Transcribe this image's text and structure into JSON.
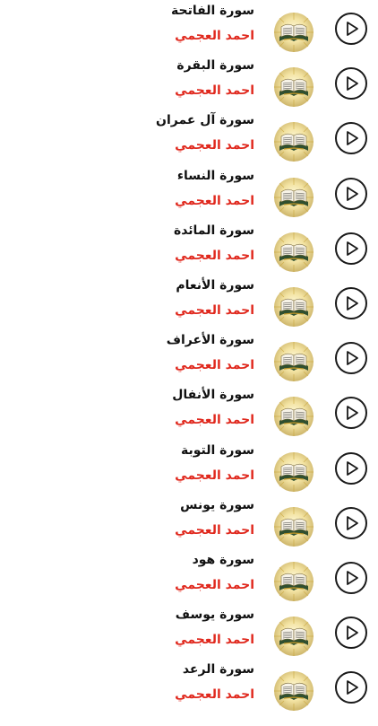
{
  "surahs": [
    {
      "title": "سورة الفاتحة",
      "reciter": "احمد العجمي"
    },
    {
      "title": "سورة البقرة",
      "reciter": "احمد العجمي"
    },
    {
      "title": "سورة آل عمران",
      "reciter": "احمد العجمي"
    },
    {
      "title": "سورة النساء",
      "reciter": "احمد العجمي"
    },
    {
      "title": "سورة المائدة",
      "reciter": "احمد العجمي"
    },
    {
      "title": "سورة الأنعام",
      "reciter": "احمد العجمي"
    },
    {
      "title": "سورة الأعراف",
      "reciter": "احمد العجمي"
    },
    {
      "title": "سورة الأنفال",
      "reciter": "احمد العجمي"
    },
    {
      "title": "سورة التوبة",
      "reciter": "احمد العجمي"
    },
    {
      "title": "سورة يونس",
      "reciter": "احمد العجمي"
    },
    {
      "title": "سورة هود",
      "reciter": "احمد العجمي"
    },
    {
      "title": "سورة يوسف",
      "reciter": "احمد العجمي"
    },
    {
      "title": "سورة الرعد",
      "reciter": "احمد العجمي"
    }
  ],
  "icons": {
    "play": "play-icon",
    "thumbnail": "quran-book-icon"
  },
  "colors": {
    "reciter": "#e0281d",
    "title": "#111111"
  }
}
